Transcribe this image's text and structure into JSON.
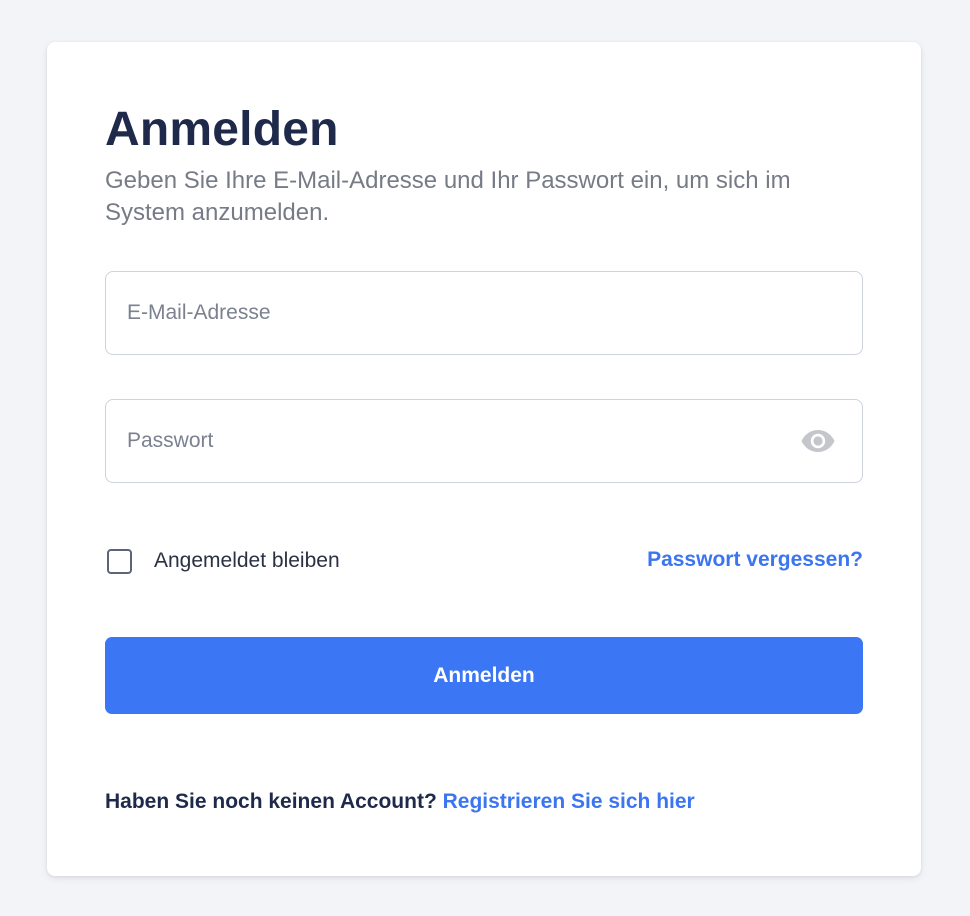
{
  "login": {
    "title": "Anmelden",
    "subtitle": "Geben Sie Ihre E-Mail-Adresse und Ihr Passwort ein, um sich im System anzumelden.",
    "email": {
      "placeholder": "E-Mail-Adresse",
      "value": ""
    },
    "password": {
      "placeholder": "Passwort",
      "value": "",
      "toggle_icon": "eye-icon"
    },
    "remember": {
      "label": "Angemeldet bleiben",
      "checked": false
    },
    "forgot_link": "Passwort vergessen?",
    "submit_label": "Anmelden",
    "footer": {
      "prompt": "Haben Sie noch keinen Account?",
      "register_link": "Registrieren Sie sich hier"
    }
  },
  "colors": {
    "page_background": "#f3f4f8",
    "card_background": "#ffffff",
    "heading": "#1f2a4a",
    "muted_text": "#767b86",
    "accent": "#3b76f4"
  }
}
